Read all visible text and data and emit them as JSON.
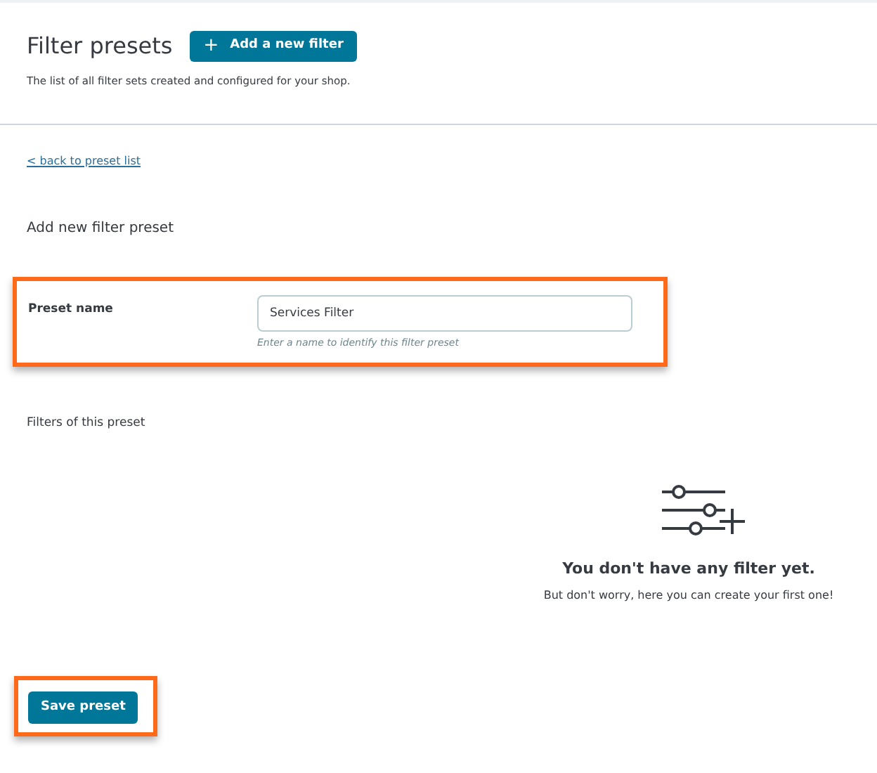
{
  "header": {
    "title": "Filter presets",
    "add_button": {
      "icon": "+",
      "label": "Add a new filter"
    },
    "subtitle": "The list of all filter sets created and configured for your shop."
  },
  "back_link": "< back to preset list",
  "form_title": "Add new filter preset",
  "preset_name": {
    "label": "Preset name",
    "value": "Services Filter",
    "hint": "Enter a name to identify this filter preset"
  },
  "filters_section": {
    "title": "Filters of this preset",
    "empty_title": "You don't have any filter yet.",
    "empty_text": "But don't worry, here you can create your first one!"
  },
  "save_button": "Save preset"
}
